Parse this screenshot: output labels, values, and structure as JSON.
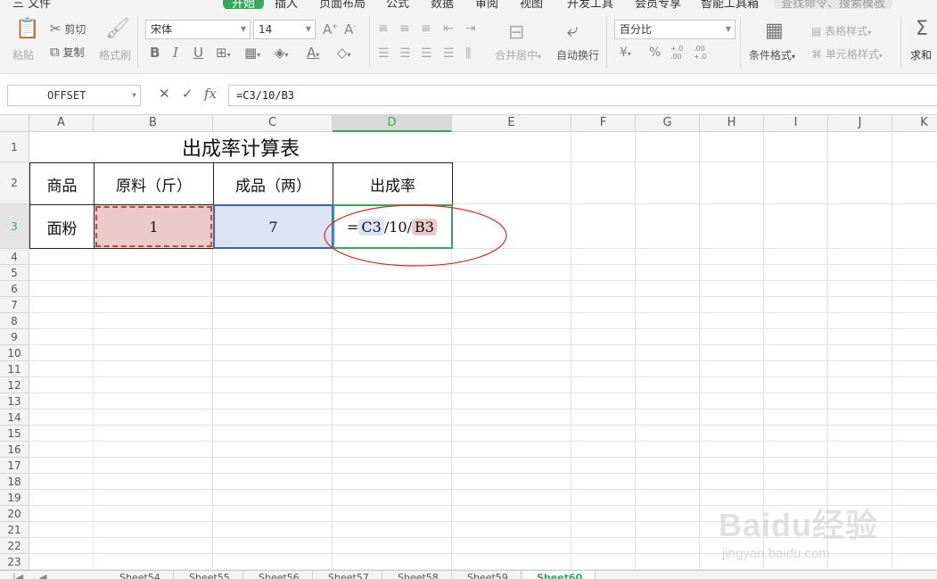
{
  "menu": {
    "items": [
      "三 文件",
      "开始",
      "插入",
      "页面布局",
      "公式",
      "数据",
      "审阅",
      "视图",
      "开发工具",
      "会员专享",
      "智能工具箱"
    ],
    "search_placeholder": "查找命令、搜索模板"
  },
  "ribbon": {
    "paste": "粘贴",
    "cut": "剪切",
    "copy": "复制",
    "format_painter": "格式刷",
    "font_name": "宋体",
    "font_size": "14",
    "merge_center": "合并居中",
    "wrap_text": "自动换行",
    "number_format": "百分比",
    "conditional_format": "条件格式",
    "table_style": "表格样式",
    "cell_style": "单元格样式",
    "sum": "求和",
    "currency": "¥",
    "percent": "%",
    "increase_decimal": "+.0 .00",
    "decrease_decimal": ".00 +.0"
  },
  "formula_bar": {
    "name_box": "OFFSET",
    "cancel": "✕",
    "confirm": "✓",
    "fx": "fx",
    "formula": "=C3/10/B3"
  },
  "columns": [
    "A",
    "B",
    "C",
    "D",
    "E",
    "F",
    "G",
    "H",
    "I",
    "J",
    "K"
  ],
  "rows": [
    "1",
    "2",
    "3",
    "4",
    "5",
    "6",
    "7",
    "8",
    "9",
    "10",
    "11",
    "12",
    "13",
    "14",
    "15",
    "16",
    "17",
    "18",
    "19",
    "20",
    "21",
    "22",
    "23"
  ],
  "table": {
    "title": "出成率计算表",
    "headers": [
      "商品",
      "原料（斤）",
      "成品（两）",
      "出成率"
    ],
    "row": {
      "item": "面粉",
      "raw": "1",
      "product": "7",
      "formula_parts": [
        "=",
        "C3",
        "/10/",
        "B3"
      ]
    }
  },
  "sheets": [
    "Sheet54",
    "Sheet55",
    "Sheet56",
    "Sheet57",
    "Sheet58",
    "Sheet59",
    "Sheet60"
  ],
  "watermark": {
    "brand": "Baidu经验",
    "url": "jingyan.baidu.com"
  },
  "colors": {
    "accent": "#3aa65d",
    "ref_c3_fill": "#dbe3f4",
    "ref_b3_fill": "#ebcaca",
    "ref_c3_border": "#3d64b8",
    "ref_b3_border": "#b84848",
    "annotation": "#d42c2c"
  }
}
